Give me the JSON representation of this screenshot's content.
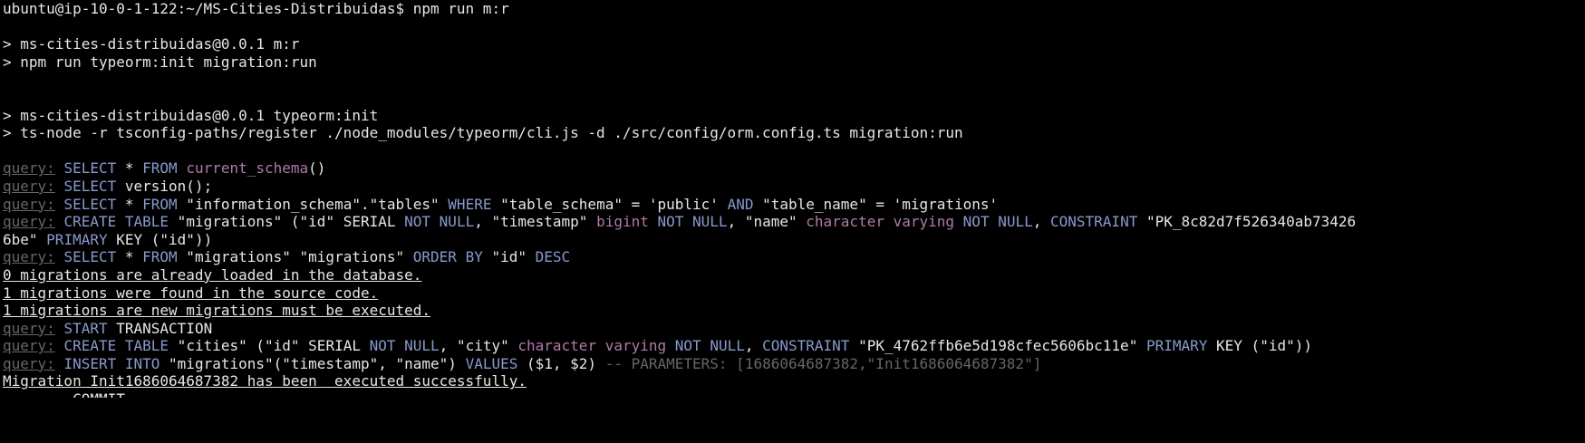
{
  "terminal": {
    "prompt_line": "ubuntu@ip-10-0-1-122:~/MS-Cities-Distribuidas$ npm run m:r",
    "lines": {
      "npm_header_1": "> ms-cities-distribuidas@0.0.1 m:r",
      "npm_header_2": "> npm run typeorm:init migration:run",
      "npm_header_3": "> ms-cities-distribuidas@0.0.1 typeorm:init",
      "npm_header_4": "> ts-node -r tsconfig-paths/register ./node_modules/typeorm/cli.js -d ./src/config/orm.config.ts migration:run"
    },
    "query_label": "query:",
    "q1": {
      "kw1": "SELECT",
      "t1": " * ",
      "kw2": "FROM",
      "t2": " ",
      "fn": "current_schema",
      "t3": "()"
    },
    "q2": {
      "kw1": "SELECT",
      "t1": " version();"
    },
    "q3": {
      "kw1": "SELECT",
      "t1": " * ",
      "kw2": "FROM",
      "t2": " \"information_schema\".\"tables\" ",
      "kw3": "WHERE",
      "t3": " \"table_schema\" = 'public' ",
      "kw4": "AND",
      "t4": " \"table_name\" = 'migrations'"
    },
    "q4": {
      "kw1": "CREATE",
      "t1": " ",
      "kw2": "TABLE",
      "t2": " \"migrations\" (\"id\" SERIAL ",
      "kw3": "NOT NULL",
      "t3": ", \"timestamp\" ",
      "fn1": "bigint",
      "t4": " ",
      "kw4": "NOT NULL",
      "t5": ", \"name\" ",
      "fn2": "character varying",
      "t6": " ",
      "kw5": "NOT NULL",
      "t7": ", ",
      "kw6": "CONSTRAINT",
      "t8": " \"PK_8c82d7f526340ab73426",
      "cont_t1": "6be\" ",
      "cont_kw1": "PRIMARY",
      "cont_t2": " KEY (\"id\"))"
    },
    "q5": {
      "kw1": "SELECT",
      "t1": " * ",
      "kw2": "FROM",
      "t2": " \"migrations\" \"migrations\" ",
      "kw3": "ORDER BY",
      "t3": " \"id\" ",
      "kw4": "DESC"
    },
    "msg1": "0 migrations are already loaded in the database.",
    "msg2": "1 migrations were found in the source code.",
    "msg3": "1 migrations are new migrations must be executed.",
    "q6": {
      "kw1": "START",
      "t1": " TRANSACTION"
    },
    "q7": {
      "kw1": "CREATE",
      "t1": " ",
      "kw2": "TABLE",
      "t2": " \"cities\" (\"id\" SERIAL ",
      "kw3": "NOT NULL",
      "t3": ", \"city\" ",
      "fn1": "character varying",
      "t4": " ",
      "kw4": "NOT NULL",
      "t5": ", ",
      "kw5": "CONSTRAINT",
      "t6": " \"PK_4762ffb6e5d198cfec5606bc11e\" ",
      "kw6": "PRIMARY",
      "t7": " KEY (\"id\"))"
    },
    "q8": {
      "kw1": "INSERT INTO",
      "t1": " \"migrations\"(\"timestamp\", \"name\") ",
      "kw2": "VALUES",
      "t2": " ($1, $2) ",
      "dim": "-- PARAMETERS: [1686064687382,\"Init1686064687382\"]"
    },
    "msg4": "Migration Init1686064687382 has been  executed successfully.",
    "partial": "        COMMIT"
  }
}
